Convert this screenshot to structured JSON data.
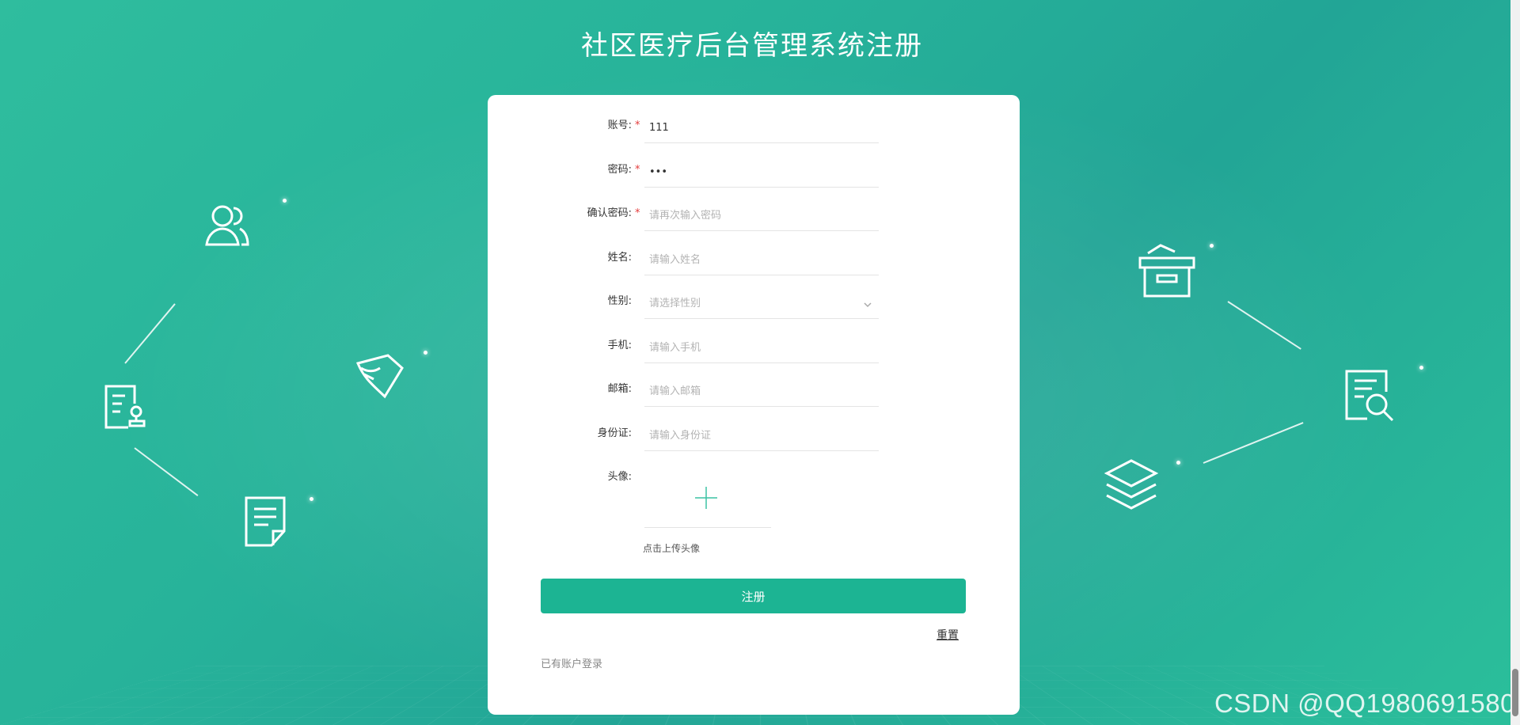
{
  "app": {
    "title": "社区医疗后台管理系统注册"
  },
  "form": {
    "username": {
      "label": "账号:",
      "required": true,
      "value": "111",
      "placeholder": ""
    },
    "password": {
      "label": "密码:",
      "required": true,
      "value": "111",
      "placeholder": ""
    },
    "confirm_password": {
      "label": "确认密码:",
      "required": true,
      "value": "",
      "placeholder": "请再次输入密码"
    },
    "name": {
      "label": "姓名:",
      "value": "",
      "placeholder": "请输入姓名"
    },
    "gender": {
      "label": "性别:",
      "value": "",
      "placeholder": "请选择性别"
    },
    "phone": {
      "label": "手机:",
      "value": "",
      "placeholder": "请输入手机"
    },
    "email": {
      "label": "邮箱:",
      "value": "",
      "placeholder": "请输入邮箱"
    },
    "id_card": {
      "label": "身份证:",
      "value": "",
      "placeholder": "请输入身份证"
    },
    "avatar": {
      "label": "头像:",
      "hint": "点击上传头像"
    },
    "required_mark": "*"
  },
  "actions": {
    "submit_label": "注册",
    "reset_label": "重置",
    "login_link": "已有账户登录"
  },
  "watermark": "CSDN @QQ1980691580",
  "colors": {
    "accent": "#1cb493",
    "required": "#e43c3c",
    "background": "#27b39a"
  },
  "icons": {
    "left": [
      "users-icon",
      "sign-document-icon",
      "graduation-icon",
      "document-icon"
    ],
    "right": [
      "archive-box-icon",
      "search-document-icon",
      "layers-icon"
    ]
  }
}
